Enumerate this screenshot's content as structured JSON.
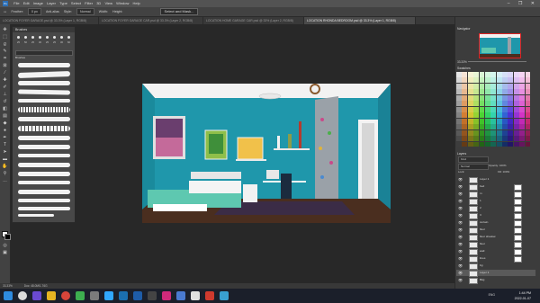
{
  "menubar": {
    "app_icon": "Ps",
    "items": [
      "File",
      "Edit",
      "Image",
      "Layer",
      "Type",
      "Select",
      "Filter",
      "3D",
      "View",
      "Window",
      "Help"
    ],
    "window_controls": "– ❐ ✕"
  },
  "options": {
    "feather": "Feather:",
    "feather_value": "0 px",
    "antialias": "Anti-alias",
    "style_label": "Style:",
    "style_value": "Normal",
    "width_label": "Width:",
    "height_label": "Height:",
    "select_subject": "Select and Mask..."
  },
  "tabs": [
    {
      "label": "LOCATION FOYER GARAGE.psd @ 33.3% (Layer 1, RGB/8)",
      "active": false
    },
    {
      "label": "LOCATION FOYER GARAGE CAR.psd @ 33.3% (Layer 2, RGB/8)",
      "active": false
    },
    {
      "label": "LOCATION HOME GARAGE CAR.psd @ 33% (Layer 2, RGB/8)",
      "active": false
    },
    {
      "label": "LOCATION RHONDA BEDROOM.psd @ 33.3% (Layer 1, RGB/8)",
      "active": true
    }
  ],
  "brush_panel": {
    "title": "Brushes",
    "presets": [
      "25",
      "50",
      "25",
      "30",
      "25",
      "25",
      "36",
      "60"
    ],
    "group": "Brushes"
  },
  "status": {
    "zoom": "33.33%",
    "doc": "Doc: 48.0M/1.76G"
  },
  "right": {
    "navigator_title": "Navigator",
    "zoom": "33.33%",
    "swatches_title": "Swatches",
    "layers_title": "Layers",
    "kind": "Kind",
    "blend": "Normal",
    "opacity": "Opacity: 100%",
    "lock": "Lock:",
    "fill": "Fill: 100%",
    "layers": [
      {
        "name": "Layer 1",
        "selected": false
      },
      {
        "name": "bed",
        "selected": false
      },
      {
        "name": "m",
        "selected": false
      },
      {
        "name": "1",
        "selected": false
      },
      {
        "name": "2",
        "selected": false
      },
      {
        "name": "3",
        "selected": false
      },
      {
        "name": "curtain",
        "selected": false
      },
      {
        "name": "floor",
        "selected": false
      },
      {
        "name": "floor shadow",
        "selected": false
      },
      {
        "name": "floor",
        "selected": false
      },
      {
        "name": "wall",
        "selected": false
      },
      {
        "name": "lines",
        "selected": false
      },
      {
        "name": "bg",
        "selected": false
      },
      {
        "name": "Layer 1",
        "selected": true
      },
      {
        "name": "Bkg",
        "selected": false
      }
    ]
  },
  "taskbar": {
    "time": "1:44 PM",
    "date": "2022-01-07",
    "tray": "ENG"
  },
  "colors": {
    "wall": "#1f97ab",
    "ceiling": "#f3f3f3",
    "floor": "#4a2e1f",
    "rug": "#3b2c46",
    "bedding": "#5ec8b0"
  }
}
